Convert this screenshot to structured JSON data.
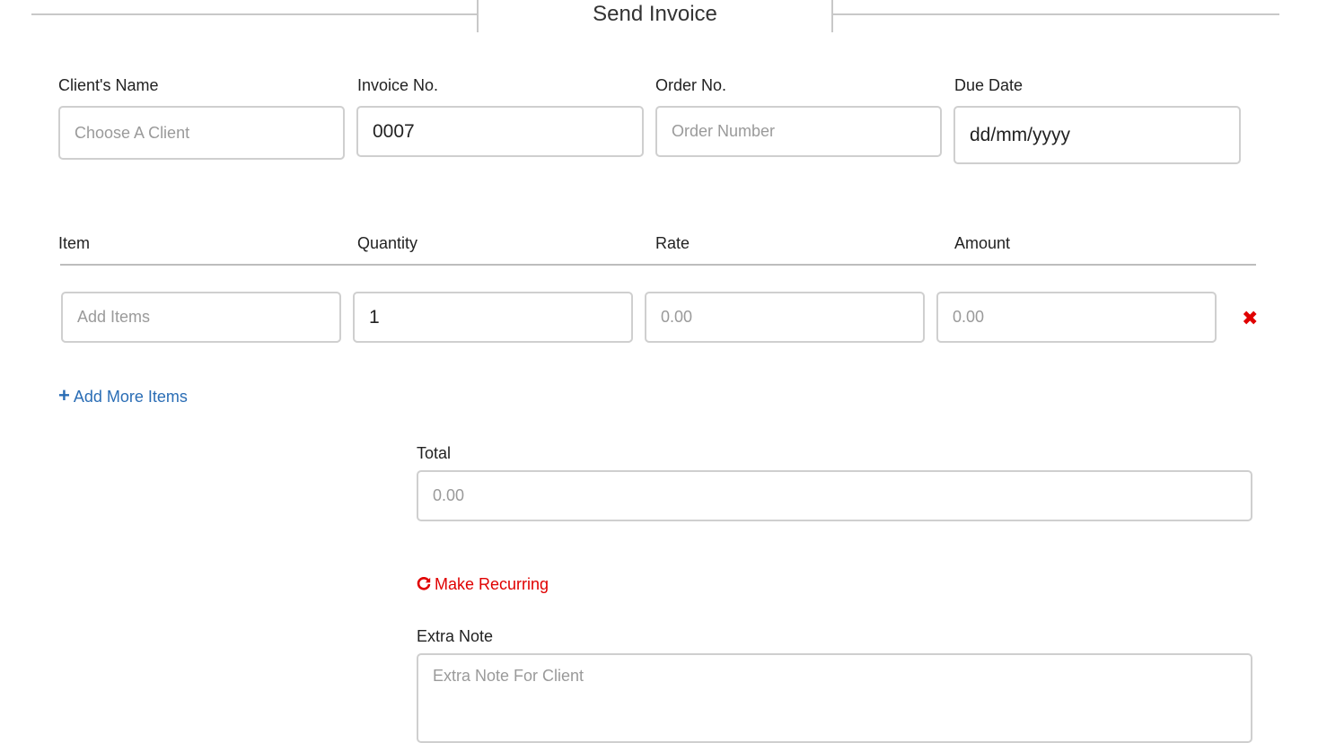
{
  "header": {
    "title": "Send Invoice"
  },
  "details": {
    "client": {
      "label": "Client's Name",
      "placeholder": "Choose A Client",
      "value": ""
    },
    "invoice": {
      "label": "Invoice No.",
      "value": "0007"
    },
    "order": {
      "label": "Order No.",
      "placeholder": "Order Number",
      "value": ""
    },
    "due": {
      "label": "Due Date",
      "value": "dd/mm/yyyy"
    }
  },
  "items_table": {
    "columns": [
      "Item",
      "Quantity",
      "Rate",
      "Amount"
    ],
    "rows": [
      {
        "item_placeholder": "Add Items",
        "quantity": "1",
        "rate_placeholder": "0.00",
        "amount_placeholder": "0.00"
      }
    ],
    "remove_icon": "close-icon"
  },
  "add_more": {
    "label": "Add More Items",
    "icon": "plus-icon"
  },
  "total": {
    "label": "Total",
    "placeholder": "0.00"
  },
  "recurring": {
    "label": "Make Recurring",
    "icon": "refresh-icon"
  },
  "note": {
    "label": "Extra Note",
    "placeholder": "Extra Note For Client"
  },
  "colors": {
    "link_blue": "#2a6db5",
    "recurring_red": "#e00000",
    "border_gray": "#cfcfcf"
  }
}
